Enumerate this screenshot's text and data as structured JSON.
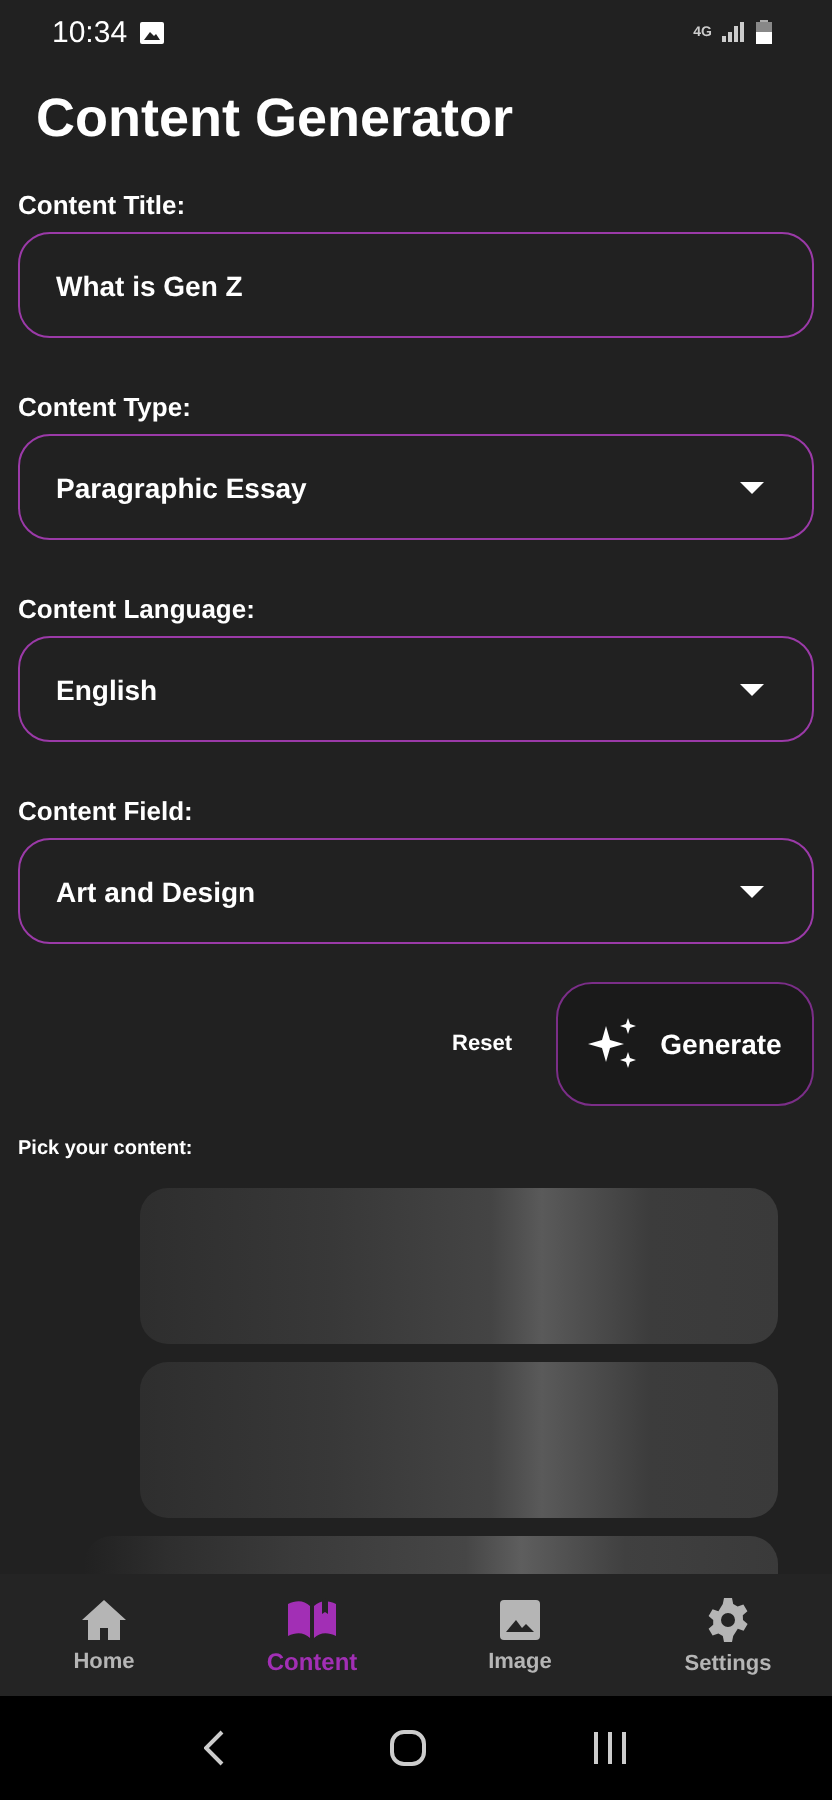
{
  "status_bar": {
    "time": "10:34",
    "network": "4G"
  },
  "title": "Content Generator",
  "fields": [
    {
      "label": "Content Title:",
      "kind": "text",
      "value": "What is Gen Z"
    },
    {
      "label": "Content Type:",
      "kind": "dropdown",
      "value": "Paragraphic Essay"
    },
    {
      "label": "Content Language:",
      "kind": "dropdown",
      "value": "English"
    },
    {
      "label": "Content Field:",
      "kind": "dropdown",
      "value": "Art and Design"
    }
  ],
  "actions": {
    "reset": "Reset",
    "generate": "Generate"
  },
  "pick_label": "Pick your content:",
  "bottom_nav": [
    {
      "label": "Home",
      "kind": "home",
      "selected": false
    },
    {
      "label": "Content",
      "kind": "book",
      "selected": true
    },
    {
      "label": "Image",
      "kind": "image",
      "selected": false
    },
    {
      "label": "Settings",
      "kind": "settings",
      "selected": false
    }
  ]
}
